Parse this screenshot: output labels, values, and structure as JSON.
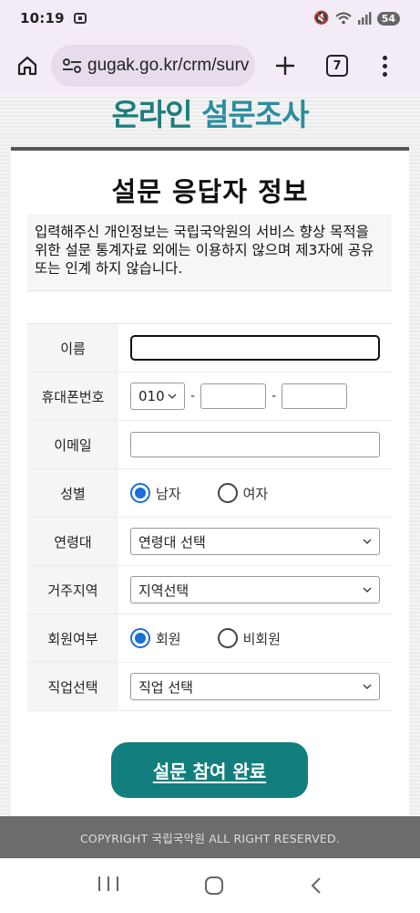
{
  "status": {
    "time": "10:19",
    "battery": "54"
  },
  "browser": {
    "url": "gugak.go.kr/crm/surv",
    "tab_count": "7"
  },
  "site": {
    "title_part1": "온라인",
    "title_part2": "설문조사"
  },
  "form": {
    "title": "설문 응답자 정보",
    "notice": "입력해주신 개인정보는 국립국악원의 서비스 향상 목적을 위한 설문 통계자료 외에는 이용하지 않으며 제3자에 공유 또는 인계 하지 않습니다.",
    "fields": {
      "name_label": "이름",
      "phone_label": "휴대폰번호",
      "phone_prefix": "010",
      "phone_dash": "-",
      "email_label": "이메일",
      "gender_label": "성별",
      "gender_male": "남자",
      "gender_female": "여자",
      "age_label": "연령대",
      "age_select": "연령대 선택",
      "region_label": "거주지역",
      "region_select": "지역선택",
      "member_label": "회원여부",
      "member_yes": "회원",
      "member_no": "비회원",
      "job_label": "직업선택",
      "job_select": "직업 선택"
    },
    "submit": "설문 참여 완료"
  },
  "footer": {
    "copyright": "COPYRIGHT 국립국악원 ALL RIGHT RESERVED."
  }
}
